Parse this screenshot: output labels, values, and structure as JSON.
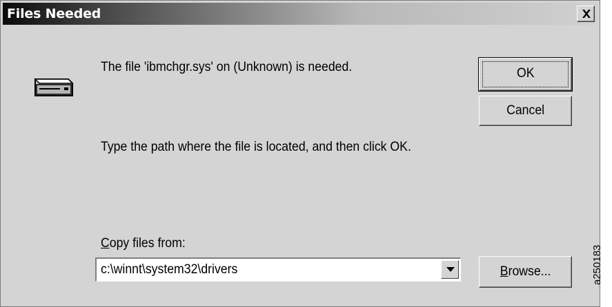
{
  "window": {
    "title": "Files Needed",
    "close_symbol": "close-icon"
  },
  "message": "The file 'ibmchgr.sys' on (Unknown) is needed.",
  "instruction": "Type the path where the file is located, and then click OK.",
  "copy_from": {
    "label_accel": "C",
    "label_rest": "opy files from:",
    "value": "c:\\winnt\\system32\\drivers"
  },
  "buttons": {
    "ok": "OK",
    "cancel": "Cancel",
    "browse_accel": "B",
    "browse_rest": "rowse..."
  },
  "figure_code": "a250183",
  "icons": {
    "drive": "drive-icon",
    "dropdown": "chevron-down-icon"
  }
}
